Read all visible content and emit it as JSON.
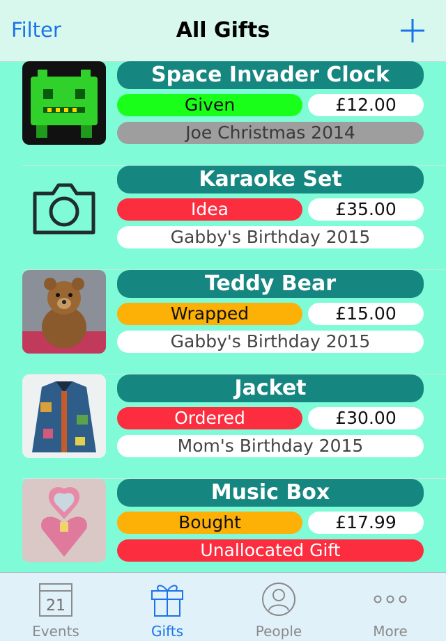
{
  "navbar": {
    "filter_label": "Filter",
    "title": "All Gifts",
    "add_icon": "plus-icon",
    "accent": "#1a73e8"
  },
  "gifts": [
    {
      "name": "Space Invader Clock",
      "status": "Given",
      "status_color": "#1aff1a",
      "status_text_color": "#111111",
      "price": "£12.00",
      "event": "Joe Christmas 2014",
      "event_bg": "#9e9e9e",
      "event_text_color": "#3a3a3a",
      "image": "photo"
    },
    {
      "name": "Karaoke Set",
      "status": "Idea",
      "status_color": "#fb2d3f",
      "status_text_color": "#ffffff",
      "price": "£35.00",
      "event": "Gabby's Birthday 2015",
      "event_bg": "#ffffff",
      "event_text_color": "#444444",
      "image": "camera-icon"
    },
    {
      "name": "Teddy Bear",
      "status": "Wrapped",
      "status_color": "#fdb006",
      "status_text_color": "#111111",
      "price": "£15.00",
      "event": "Gabby's Birthday 2015",
      "event_bg": "#ffffff",
      "event_text_color": "#444444",
      "image": "photo"
    },
    {
      "name": "Jacket",
      "status": "Ordered",
      "status_color": "#fb2d3f",
      "status_text_color": "#ffffff",
      "price": "£30.00",
      "event": "Mom's Birthday 2015",
      "event_bg": "#ffffff",
      "event_text_color": "#444444",
      "image": "photo"
    },
    {
      "name": "Music Box",
      "status": "Bought",
      "status_color": "#fdb006",
      "status_text_color": "#111111",
      "price": "£17.99",
      "event": "Unallocated Gift",
      "event_bg": "#fb2d3f",
      "event_text_color": "#ffffff",
      "image": "photo"
    }
  ],
  "tabbar": {
    "tabs": [
      {
        "label": "Events",
        "icon": "calendar-icon",
        "calendar_day": "21",
        "active": false
      },
      {
        "label": "Gifts",
        "icon": "gift-icon",
        "active": true
      },
      {
        "label": "People",
        "icon": "person-icon",
        "active": false
      },
      {
        "label": "More",
        "icon": "more-icon",
        "active": false
      }
    ]
  },
  "colors": {
    "background": "#7ffbd7",
    "name_pill": "#168680",
    "tab_active": "#1a73e8",
    "tab_inactive": "#8a8a8a"
  }
}
